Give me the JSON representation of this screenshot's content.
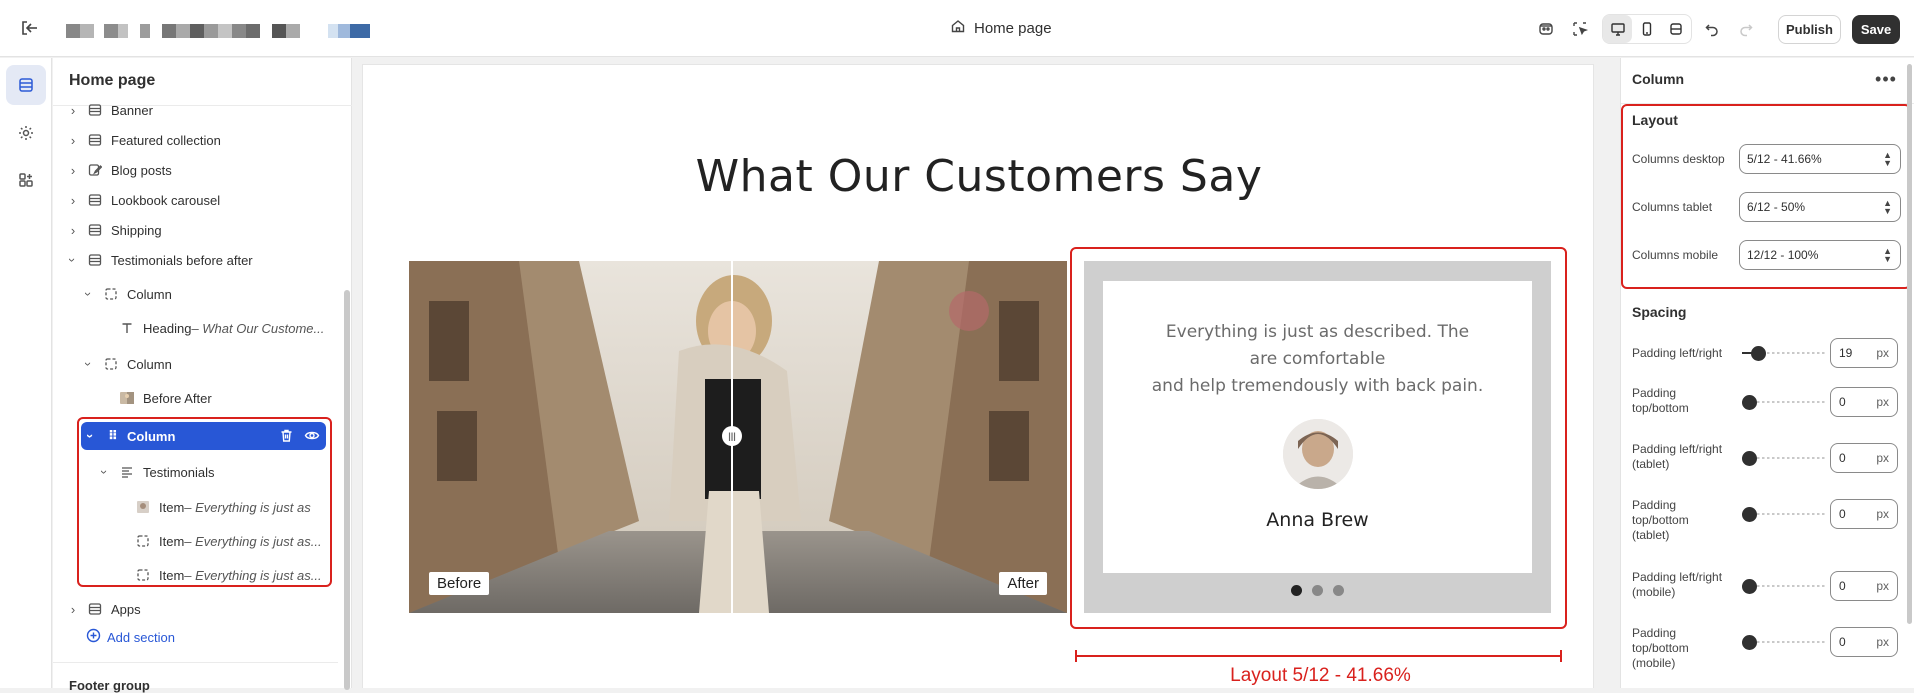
{
  "topbar": {
    "page_title": "Home page",
    "publish_label": "Publish",
    "save_label": "Save"
  },
  "sidebar": {
    "title": "Home page",
    "tree": [
      {
        "label": "Banner",
        "sub": ""
      },
      {
        "label": "Featured collection",
        "sub": ""
      },
      {
        "label": "Blog posts",
        "sub": ""
      },
      {
        "label": "Lookbook carousel",
        "sub": ""
      },
      {
        "label": "Shipping",
        "sub": ""
      },
      {
        "label": "Testimonials before after",
        "sub": ""
      },
      {
        "label": "Column",
        "sub": ""
      },
      {
        "label": "Heading",
        "sub": " – What Our Custome..."
      },
      {
        "label": "Column",
        "sub": ""
      },
      {
        "label": "Before After",
        "sub": ""
      },
      {
        "label": "Column",
        "sub": ""
      },
      {
        "label": "Testimonials",
        "sub": ""
      },
      {
        "label": "Item",
        "sub": " – Everything is just as"
      },
      {
        "label": "Item",
        "sub": " – Everything is just as..."
      },
      {
        "label": "Item",
        "sub": " – Everything is just as..."
      },
      {
        "label": "Apps",
        "sub": ""
      }
    ],
    "add_section": "Add section",
    "footer_group": "Footer group"
  },
  "preview": {
    "heading": "What Our Customers Say",
    "before_label": "Before",
    "after_label": "After",
    "quote_line1": "Everything is just as described. The",
    "quote_line2": "are comfortable",
    "quote_line3": "and help tremendously with back pain.",
    "author": "Anna Brew",
    "slides": 3,
    "active_slide": 1,
    "measure_label": "Layout 5/12 - 41.66%"
  },
  "settings": {
    "title": "Column",
    "layout_heading": "Layout",
    "columns_desktop_label": "Columns desktop",
    "columns_desktop_value": "5/12 - 41.66%",
    "columns_tablet_label": "Columns tablet",
    "columns_tablet_value": "6/12 - 50%",
    "columns_mobile_label": "Columns mobile",
    "columns_mobile_value": "12/12 - 100%",
    "spacing_heading": "Spacing",
    "padding": [
      {
        "label": "Padding left/right",
        "value": "19",
        "unit": "px"
      },
      {
        "label": "Padding top/bottom",
        "value": "0",
        "unit": "px"
      },
      {
        "label": "Padding left/right (tablet)",
        "value": "0",
        "unit": "px"
      },
      {
        "label": "Padding top/bottom (tablet)",
        "value": "0",
        "unit": "px"
      },
      {
        "label": "Padding left/right (mobile)",
        "value": "0",
        "unit": "px"
      },
      {
        "label": "Padding top/bottom (mobile)",
        "value": "0",
        "unit": "px"
      }
    ]
  },
  "colors": {
    "accent": "#2857d6",
    "highlight": "#d9211d",
    "dark": "#303030"
  }
}
